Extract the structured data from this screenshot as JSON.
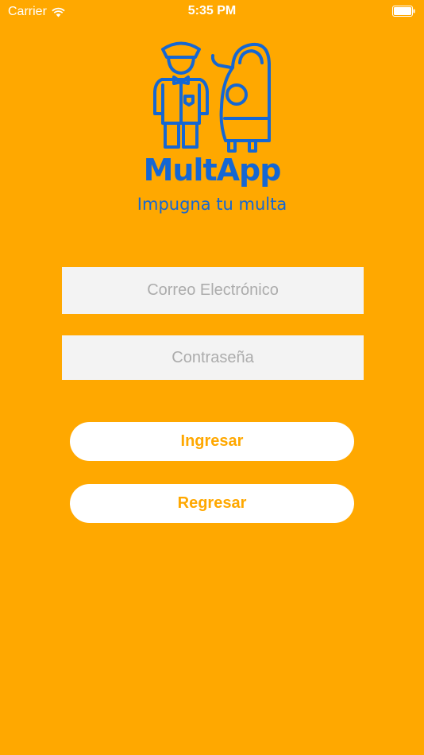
{
  "status_bar": {
    "carrier": "Carrier",
    "time": "5:35 PM",
    "icons": [
      "wifi-icon",
      "battery-icon"
    ]
  },
  "logo": {
    "title": "MultApp",
    "tagline": "Impugna tu multa",
    "illustration": [
      "police-officer-icon",
      "car-icon"
    ]
  },
  "form": {
    "email_placeholder": "Correo Electrónico",
    "email_value": "",
    "password_placeholder": "Contraseña",
    "password_value": ""
  },
  "buttons": {
    "login_label": "Ingresar",
    "back_label": "Regresar"
  },
  "colors": {
    "background": "#FFA800",
    "brand_blue": "#1567D3",
    "field_bg": "#F3F3F3",
    "placeholder": "#ACACAC",
    "button_bg": "#FFFFFF"
  }
}
